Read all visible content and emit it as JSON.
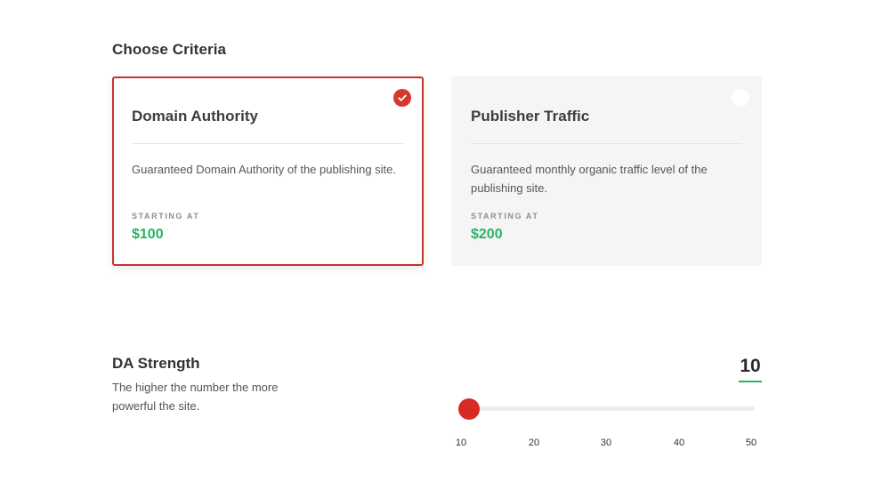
{
  "section": {
    "title": "Choose Criteria"
  },
  "cards": [
    {
      "title": "Domain Authority",
      "description": "Guaranteed Domain Authority of the publishing site.",
      "price_label": "STARTING AT",
      "price": "$100",
      "selected": true,
      "icon": "check-circle-icon"
    },
    {
      "title": "Publisher Traffic",
      "description": "Guaranteed monthly organic traffic level of the publishing site.",
      "price_label": "STARTING AT",
      "price": "$200",
      "selected": false,
      "icon": "radio-empty-icon"
    }
  ],
  "strength": {
    "title": "DA Strength",
    "description": "The higher the number the more powerful the site.",
    "value": "10",
    "min": 10,
    "max": 50,
    "ticks": [
      "10",
      "20",
      "30",
      "40",
      "50"
    ]
  },
  "colors": {
    "accent_red": "#d6372f",
    "selected_border": "#c8322d",
    "price_green": "#28b463",
    "card_bg_unselected": "#f6f5f5",
    "text_dark": "#333333"
  }
}
